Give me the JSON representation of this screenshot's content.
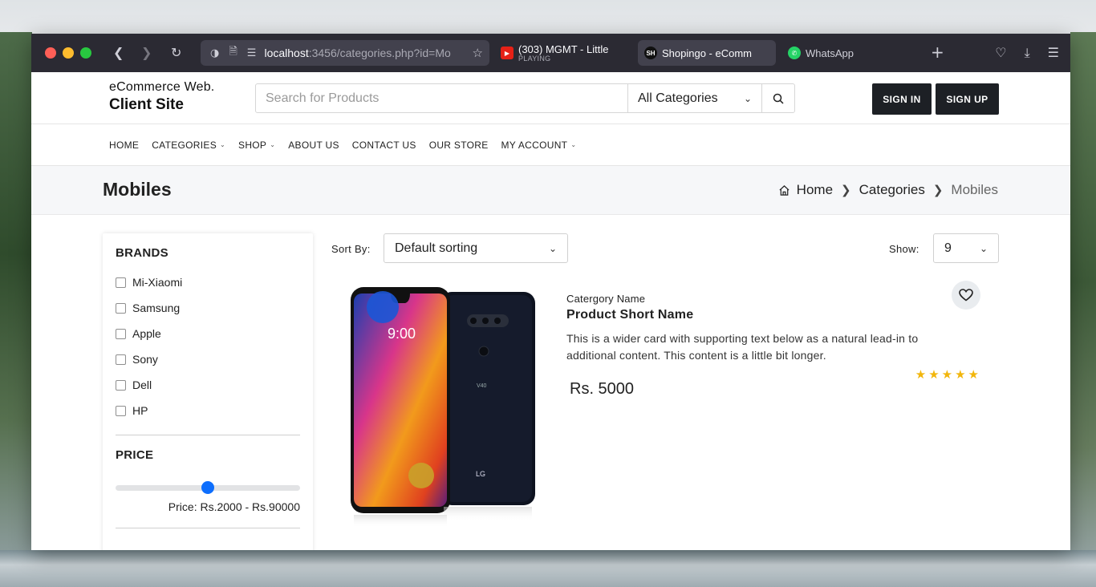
{
  "browser": {
    "url_host": "localhost",
    "url_rest": ":3456/categories.php?id=Mo",
    "tabs": [
      {
        "title": "(303) MGMT - Little",
        "sub": "PLAYING"
      },
      {
        "title": "Shopingo - eComm",
        "fav": "SH"
      },
      {
        "title": "WhatsApp"
      }
    ]
  },
  "header": {
    "logo_line1": "eCommerce Web.",
    "logo_line2": "Client Site",
    "search_placeholder": "Search for Products",
    "category_select": "All Categories",
    "sign_in": "SIGN IN",
    "sign_up": "SIGN UP"
  },
  "nav": {
    "items": [
      "HOME",
      "CATEGORIES",
      "SHOP",
      "ABOUT US",
      "CONTACT US",
      "OUR STORE",
      "MY ACCOUNT"
    ]
  },
  "page": {
    "title": "Mobiles",
    "breadcrumb": [
      "Home",
      "Categories",
      "Mobiles"
    ]
  },
  "sidebar": {
    "brands_title": "BRANDS",
    "brands": [
      "Mi-Xiaomi",
      "Samsung",
      "Apple",
      "Sony",
      "Dell",
      "HP"
    ],
    "price_title": "PRICE",
    "price_slider_fraction": 0.5,
    "price_text": "Price: Rs.2000 - Rs.90000"
  },
  "sort": {
    "label": "Sort By:",
    "value": "Default sorting",
    "show_label": "Show:",
    "show_value": "9"
  },
  "product": {
    "category": "Catergory Name",
    "name": "Product Short Name",
    "description": "This is a wider card with supporting text below as a natural lead-in to additional content. This content is a little bit longer.",
    "price": "Rs. 5000",
    "rating": 5,
    "screen_time": "9:00",
    "brand_mark": "LG"
  },
  "colors": {
    "accent": "#0d6efd",
    "dark_button": "#1d2025",
    "star": "#f2b60c"
  }
}
